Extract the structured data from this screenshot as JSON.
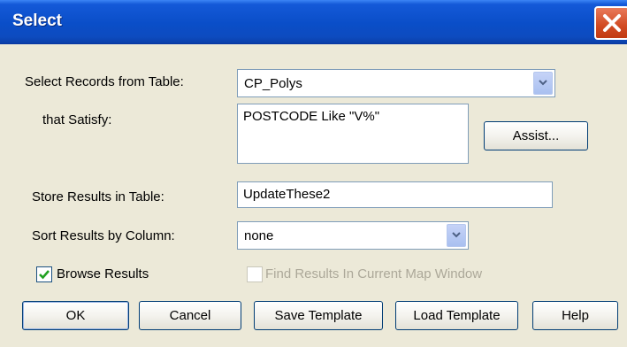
{
  "window": {
    "title": "Select"
  },
  "form": {
    "select_label": "Select Records from Table:",
    "table_value": "CP_Polys",
    "satisfy_label": "that Satisfy:",
    "condition_value": "POSTCODE Like \"V%\"",
    "store_label": "Store Results in Table:",
    "store_value": "UpdateThese2",
    "sort_label": "Sort Results by Column:",
    "sort_value": "none",
    "browse_label": "Browse Results",
    "browse_checked": true,
    "find_label": "Find Results In Current Map Window",
    "find_checked": false
  },
  "buttons": {
    "assist": "Assist...",
    "ok": "OK",
    "cancel": "Cancel",
    "save_template": "Save Template",
    "load_template": "Load Template",
    "help": "Help"
  },
  "colors": {
    "title_bar": "#0a4ec8",
    "dialog_bg": "#ece9d8",
    "close_button": "#d14a22",
    "check_mark": "#21a121"
  }
}
